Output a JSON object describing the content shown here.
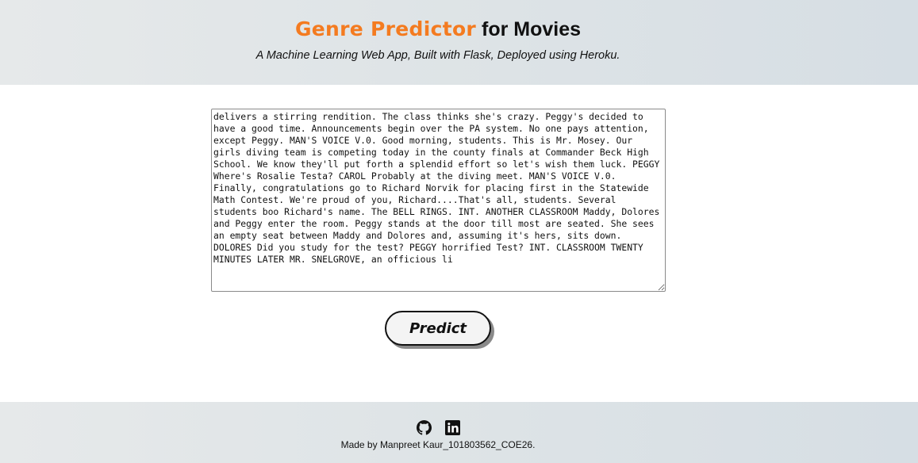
{
  "header": {
    "title_brand": "Genre Predictor",
    "title_rest": " for Movies",
    "subtitle": "A Machine Learning Web App, Built with Flask, Deployed using Heroku."
  },
  "form": {
    "script_text": "delivers a stirring rendition. The class thinks she's crazy. Peggy's decided to have a good time. Announcements begin over the PA system. No one pays attention, except Peggy. MAN'S VOICE V.0. Good morning, students. This is Mr. Mosey. Our girls diving team is competing today in the county finals at Commander Beck High School. We know they'll put forth a splendid effort so let's wish them luck. PEGGY Where's Rosalie Testa? CAROL Probably at the diving meet. MAN'S VOICE V.0. Finally, congratulations go to Richard Norvik for placing first in the Statewide Math Contest. We're proud of you, Richard....That's all, students. Several students boo Richard's name. The BELL RINGS. INT. ANOTHER CLASSROOM Maddy, Dolores and Peggy enter the room. Peggy stands at the door till most are seated. She sees an empty seat between Maddy and Dolores and, assuming it's hers, sits down. DOLORES Did you study for the test? PEGGY horrified Test? INT. CLASSROOM TWENTY MINUTES LATER MR. SNELGROVE, an officious li",
    "predict_label": "Predict"
  },
  "footer": {
    "icons": [
      "github-icon",
      "linkedin-icon"
    ],
    "credit": "Made by Manpreet Kaur_101803562_COE26."
  },
  "colors": {
    "brand": "#f47b20",
    "band_bg": "#dde3e6",
    "text": "#111111"
  }
}
